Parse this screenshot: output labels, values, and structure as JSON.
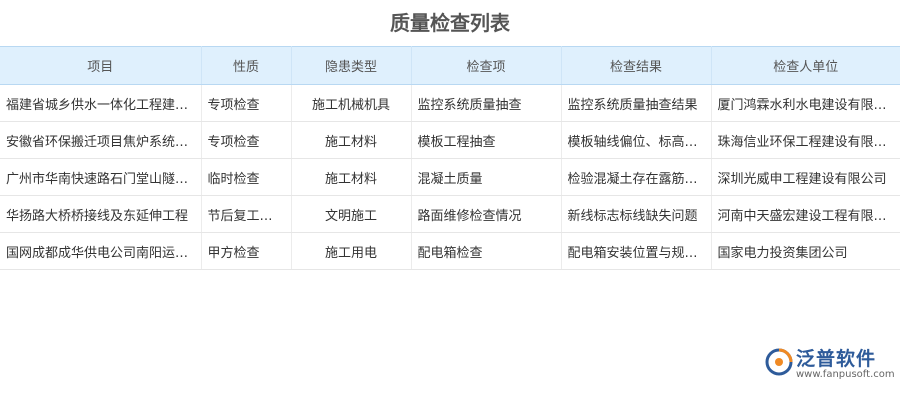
{
  "page": {
    "title": "质量检查列表"
  },
  "table": {
    "columns": [
      "项目",
      "性质",
      "隐患类型",
      "检查项",
      "检查结果",
      "检查人单位"
    ],
    "rows": [
      {
        "project": "福建省城乡供水一体化工程建设项目",
        "nature": "专项检查",
        "hazard": "施工机械机具",
        "item": "监控系统质量抽查",
        "result": "监控系统质量抽查结果",
        "unit": "厦门鸿霖水利水电建设有限公司"
      },
      {
        "project": "安徽省环保搬迁项目焦炉系统工程",
        "nature": "专项检查",
        "hazard": "施工材料",
        "item": "模板工程抽查",
        "result": "模板轴线偏位、标高偏差",
        "unit": "珠海信业环保工程建设有限公司"
      },
      {
        "project": "广州市华南快速路石门堂山隧道工程",
        "nature": "临时检查",
        "hazard": "施工材料",
        "item": "混凝土质量",
        "result": "检验混凝土存在露筋现象",
        "unit": "深圳光威申工程建设有限公司"
      },
      {
        "project": "华扬路大桥桥接线及东延伸工程",
        "nature": "节后复工检查",
        "hazard": "文明施工",
        "item": "路面维修检查情况",
        "result": "新线标志标线缺失问题",
        "unit": "河南中天盛宏建设工程有限公司"
      },
      {
        "project": "国网成都成华供电公司南阳运维站",
        "nature": "甲方检查",
        "hazard": "施工用电",
        "item": "配电箱检查",
        "result": "配电箱安装位置与规范不符",
        "unit": "国家电力投资集团公司"
      }
    ]
  },
  "brand": {
    "name": "泛普软件",
    "url": "www.fanpusoft.com",
    "icon": "fanpu-logo-icon"
  },
  "colors": {
    "header_bg": "#dff0fd",
    "link": "#1a6ec2",
    "brand_blue": "#2e5b9a",
    "brand_orange": "#f08a24"
  }
}
